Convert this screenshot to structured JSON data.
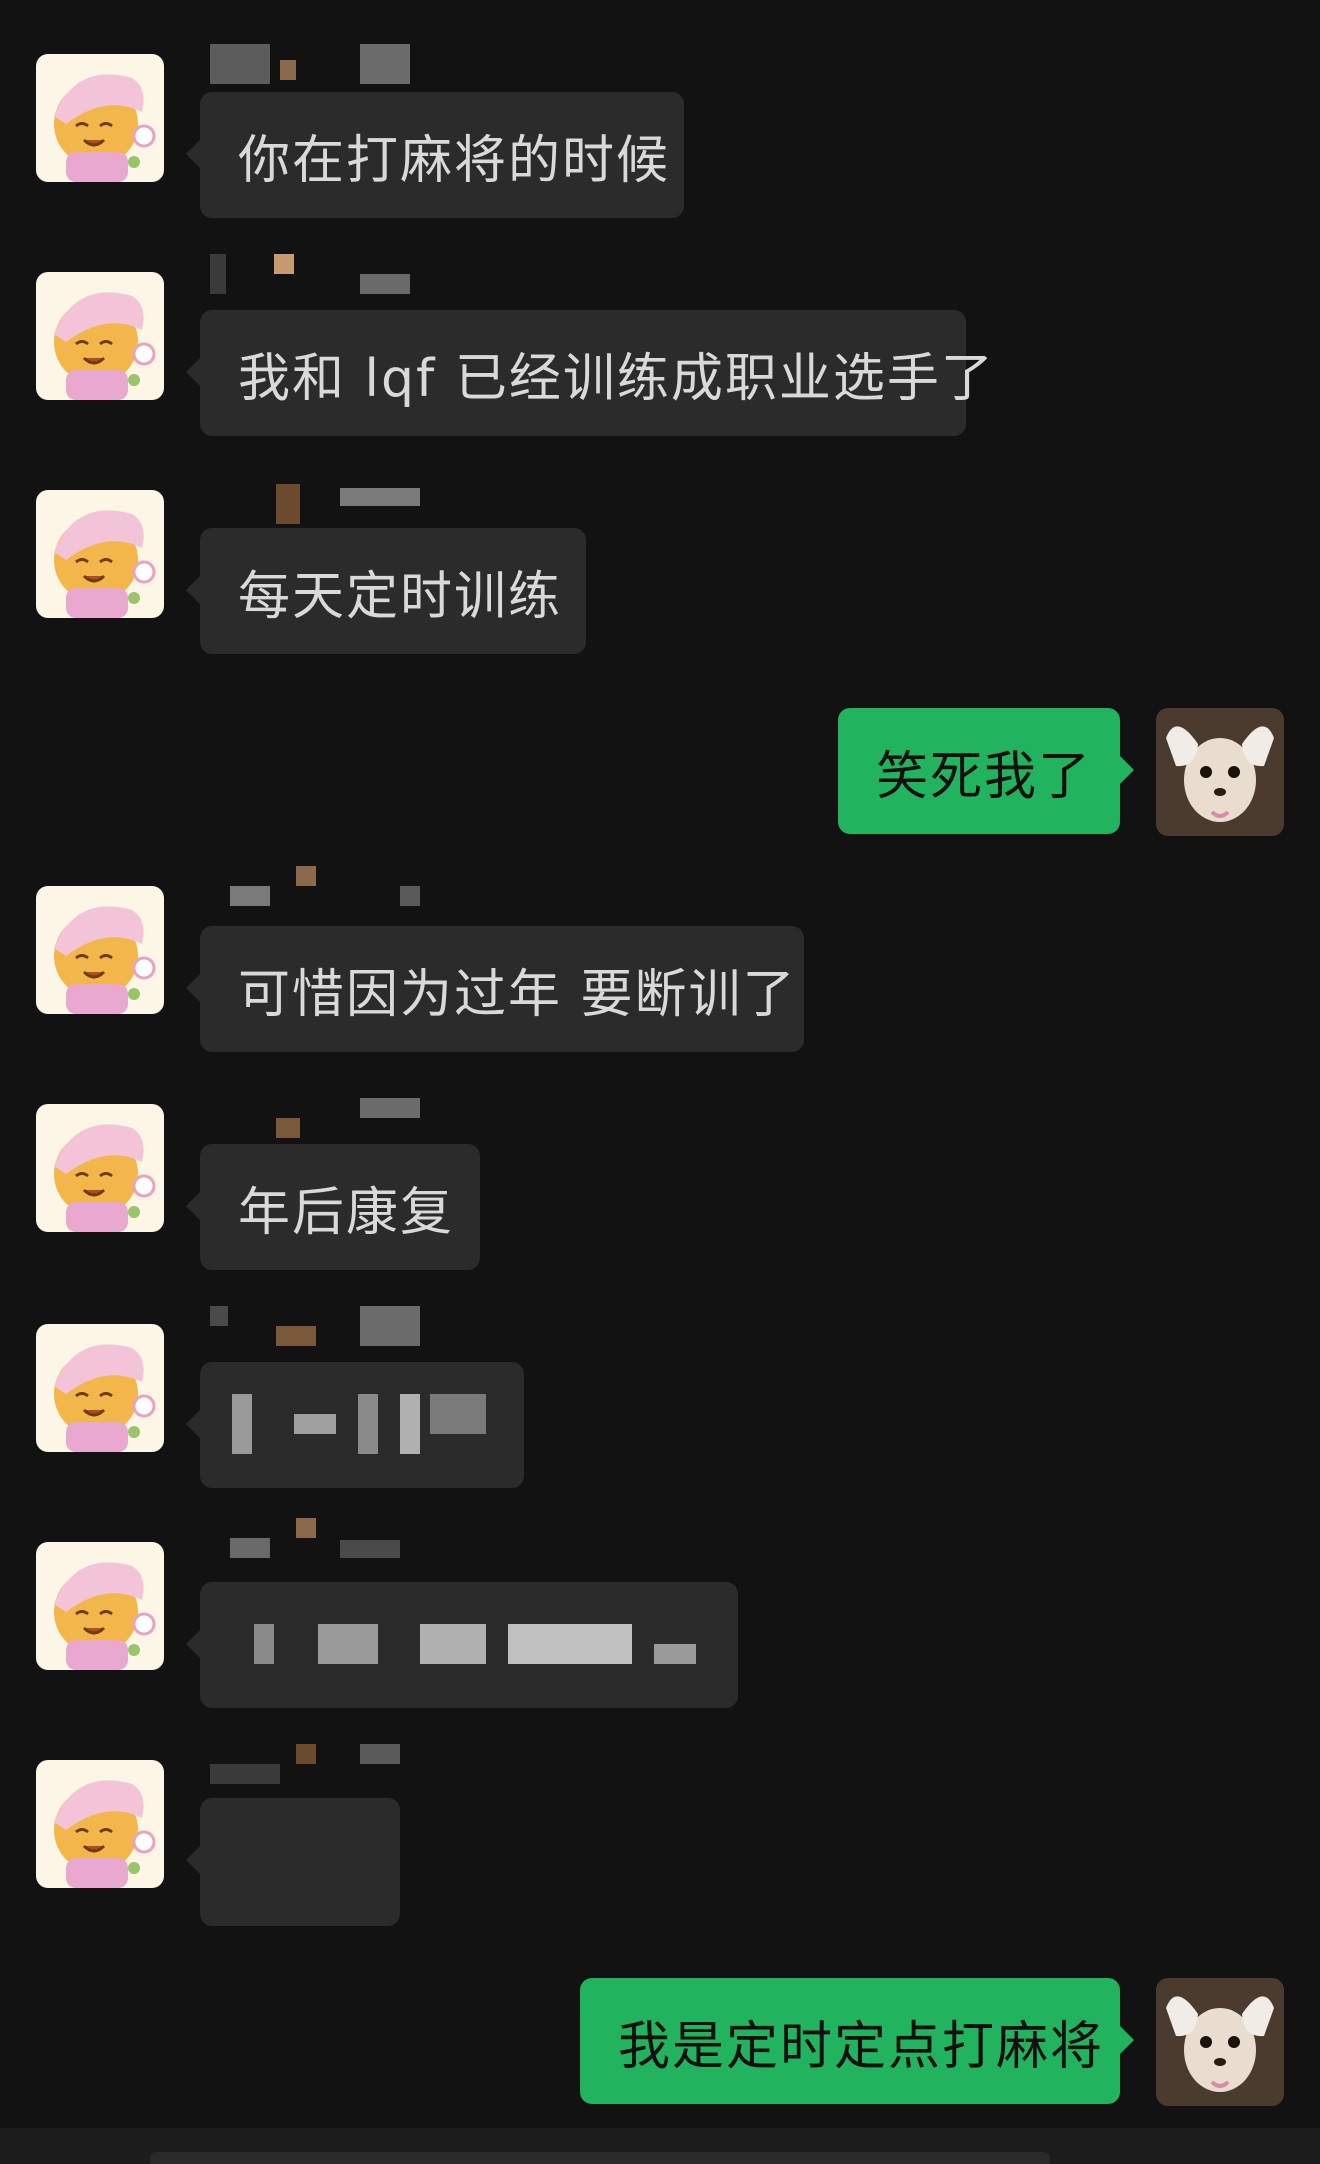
{
  "messages": [
    {
      "side": "left",
      "text": "你在打麻将的时候",
      "bubble_w": 484
    },
    {
      "side": "left",
      "text": "我和 lqf 已经训练成职业选手了",
      "bubble_w": 766
    },
    {
      "side": "left",
      "text": "每天定时训练",
      "bubble_w": 386
    },
    {
      "side": "right",
      "text": "笑死我了",
      "bubble_w": 282
    },
    {
      "side": "left",
      "text": "可惜因为过年 要断训了",
      "bubble_w": 604
    },
    {
      "side": "left",
      "text": "年后康复",
      "bubble_w": 280
    },
    {
      "side": "left",
      "text": "",
      "bubble_w": 324,
      "redacted": true
    },
    {
      "side": "left",
      "text": "",
      "bubble_w": 538,
      "redacted": true
    },
    {
      "side": "left",
      "text": "",
      "bubble_w": 200,
      "redacted": true
    },
    {
      "side": "right",
      "text": "我是定时定点打麻将",
      "bubble_w": 540
    }
  ],
  "colors": {
    "background": "#121212",
    "incoming_bubble": "#2b2b2b",
    "outgoing_bubble": "#22b35e"
  },
  "icons": {
    "contact_avatar": "sleepy-cartoon-avatar",
    "my_avatar": "chihuahua-dog-avatar"
  }
}
